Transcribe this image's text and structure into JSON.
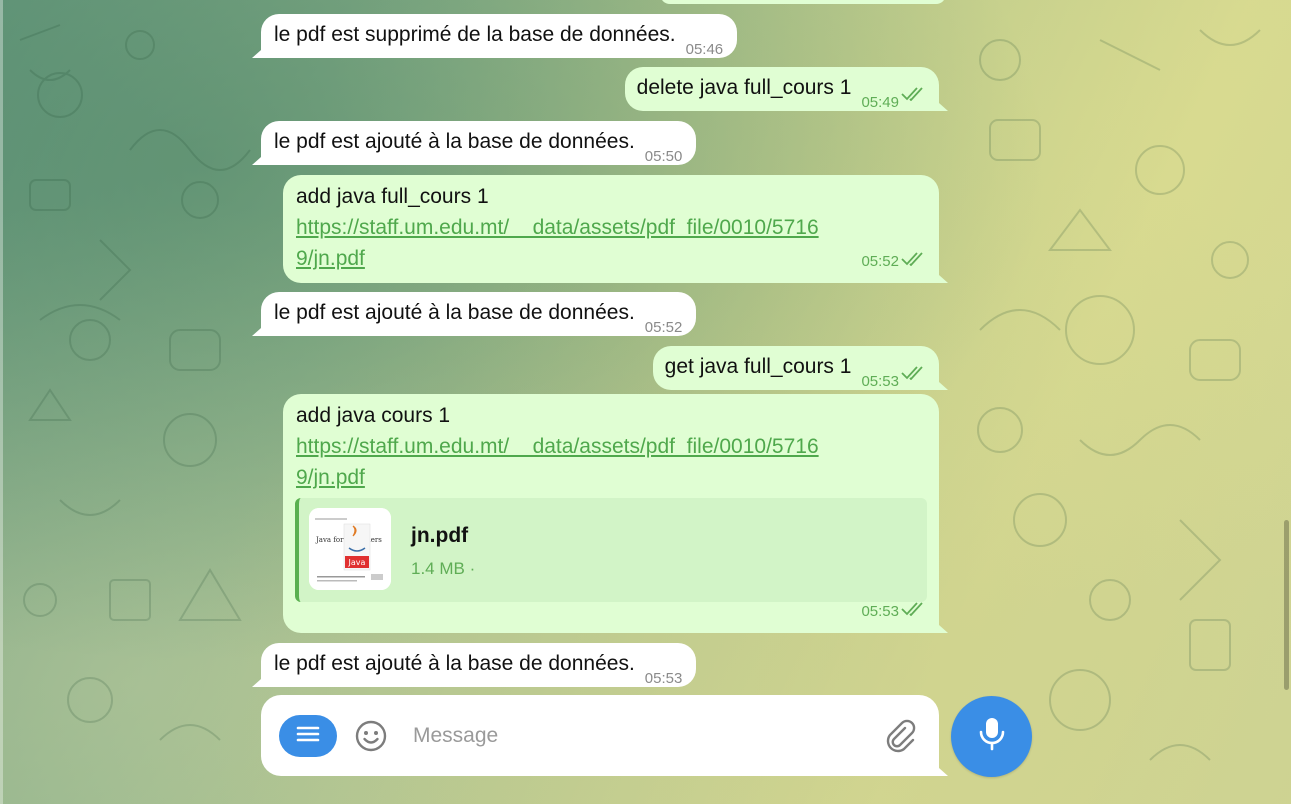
{
  "chat": {
    "messages": [
      {
        "text": "le pdf est supprimé de la base de données.",
        "time": "05:46"
      },
      {
        "text": "delete java full_cours 1",
        "time": "05:49"
      },
      {
        "text": "le pdf est ajouté à la base de données.",
        "time": "05:50"
      },
      {
        "text": "add java full_cours 1",
        "link_line1": "https://staff.um.edu.mt/__data/assets/pdf_file/0010/5716",
        "link_line2": "9/jn.pdf",
        "time": "05:52"
      },
      {
        "text": "le pdf est ajouté à la base de données.",
        "time": "05:52"
      },
      {
        "text": "get java full_cours 1",
        "time": "05:53"
      },
      {
        "text": "add java cours 1",
        "link_line1": "https://staff.um.edu.mt/__data/assets/pdf_file/0010/5716",
        "link_line2": "9/jn.pdf",
        "time": "05:53",
        "file": {
          "name": "jn.pdf",
          "size": "1.4 MB ·",
          "thumb_title": "Java for Beginners",
          "thumb_logo": "Java"
        }
      },
      {
        "text": "le pdf est ajouté à la base de données.",
        "time": "05:53"
      }
    ]
  },
  "composer": {
    "placeholder": "Message"
  },
  "colors": {
    "accent": "#3a8ee6",
    "outgoing_bubble": "#e0fed3",
    "incoming_bubble": "#ffffff",
    "link": "#4fa84c",
    "outgoing_time": "#5fad56"
  },
  "icons": {
    "menu": "menu-icon",
    "emoji": "smile-icon",
    "attach": "paperclip-icon",
    "mic": "microphone-icon",
    "read": "double-check-icon"
  }
}
